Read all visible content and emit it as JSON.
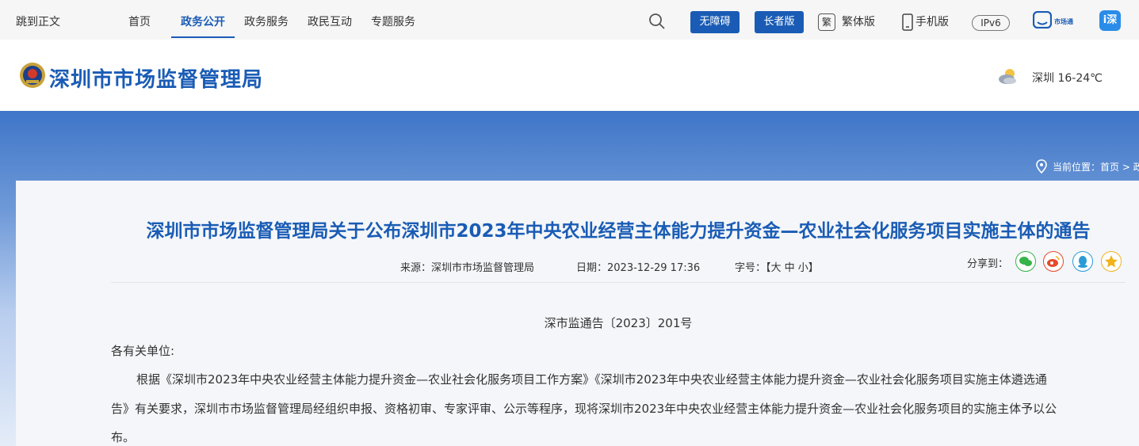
{
  "topbar": {
    "skip": "跳到正文",
    "nav": [
      "首页",
      "政务公开",
      "政务服务",
      "政民互动",
      "专题服务"
    ],
    "accessibility": "无障碍",
    "elderly": "长者版",
    "traditional_glyph": "繁",
    "traditional": "繁体版",
    "mobile": "手机版",
    "ipv6": "IPv6",
    "market_app": "市场通",
    "app_glyph": "i深"
  },
  "header": {
    "title": "深圳市市场监督管理局",
    "weather": "深圳 16-24℃"
  },
  "breadcrumb": "当前位置：首页 > 政",
  "article": {
    "title": "深圳市市场监督管理局关于公布深圳市2023年中央农业经营主体能力提升资金—农业社会化服务项目实施主体的通告",
    "source": "来源：深圳市市场监督管理局",
    "date": "日期：2023-12-29 17:36",
    "fontsize": "字号：【大  中  小】",
    "share_label": "分享到：",
    "doc_no": "深市监通告〔2023〕201号",
    "salutation": "各有关单位:",
    "lines": [
      "根据《深圳市2023年中央农业经营主体能力提升资金—农业社会化服务项目工作方案》《深圳市2023年中央农业经营主体能力提升资金—农业社会化服务项目实施主体遴选通",
      "告》有关要求，深圳市市场监督管理局经组织申报、资格初审、专家评审、公示等程序，现将深圳市2023年中央农业经营主体能力提升资金—农业社会化服务项目的实施主体予以公",
      "布。"
    ]
  },
  "colors": {
    "brand": "#1a5cb5",
    "wechat": "#37b34a",
    "weibo": "#e6492d",
    "qq": "#2a9bd6",
    "qzone": "#f2b21c"
  }
}
